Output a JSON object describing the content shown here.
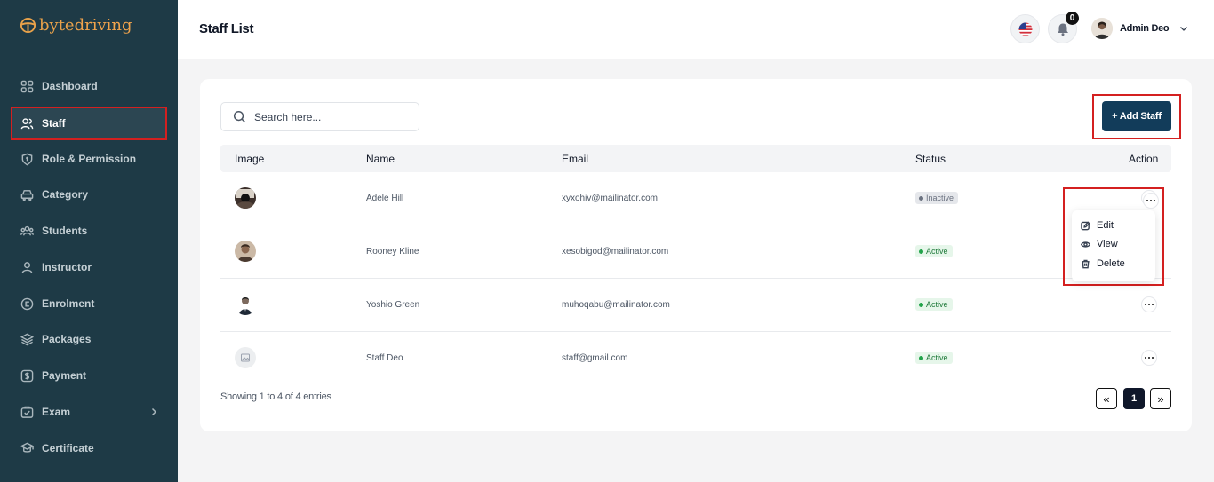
{
  "brand": {
    "logo_part1": "byte",
    "logo_part2": "driving"
  },
  "sidebar": {
    "items": [
      {
        "label": "Dashboard",
        "icon": "dashboard-icon"
      },
      {
        "label": "Staff",
        "icon": "users-icon",
        "active": true
      },
      {
        "label": "Role & Permission",
        "icon": "shield-icon"
      },
      {
        "label": "Category",
        "icon": "car-icon"
      },
      {
        "label": "Students",
        "icon": "students-icon"
      },
      {
        "label": "Instructor",
        "icon": "user-icon"
      },
      {
        "label": "Enrolment",
        "icon": "enrolment-icon"
      },
      {
        "label": "Packages",
        "icon": "layers-icon"
      },
      {
        "label": "Payment",
        "icon": "dollar-icon"
      },
      {
        "label": "Exam",
        "icon": "exam-icon",
        "has_submenu": true
      },
      {
        "label": "Certificate",
        "icon": "certificate-icon"
      }
    ]
  },
  "header": {
    "title": "Staff List",
    "notification_count": "0",
    "user_name": "Admin Deo"
  },
  "toolbar": {
    "search_placeholder": "Search here...",
    "add_label": "+ Add Staff"
  },
  "table": {
    "columns": [
      "Image",
      "Name",
      "Email",
      "Status",
      "Action"
    ],
    "rows": [
      {
        "name": "Adele Hill",
        "email": "xyxohiv@mailinator.com",
        "status": "Inactive"
      },
      {
        "name": "Rooney Kline",
        "email": "xesobigod@mailinator.com",
        "status": "Active"
      },
      {
        "name": "Yoshio Green",
        "email": "muhoqabu@mailinator.com",
        "status": "Active"
      },
      {
        "name": "Staff Deo",
        "email": "staff@gmail.com",
        "status": "Active"
      }
    ]
  },
  "action_menu": {
    "edit": "Edit",
    "view": "View",
    "delete": "Delete"
  },
  "footer": {
    "entries_text": "Showing 1 to 4 of 4 entries",
    "prev": "«",
    "current_page": "1",
    "next": "»"
  },
  "colors": {
    "sidebar_bg": "#1e3a46",
    "accent": "#123c5a",
    "brand": "#e9a24a",
    "highlight": "#d42020"
  }
}
